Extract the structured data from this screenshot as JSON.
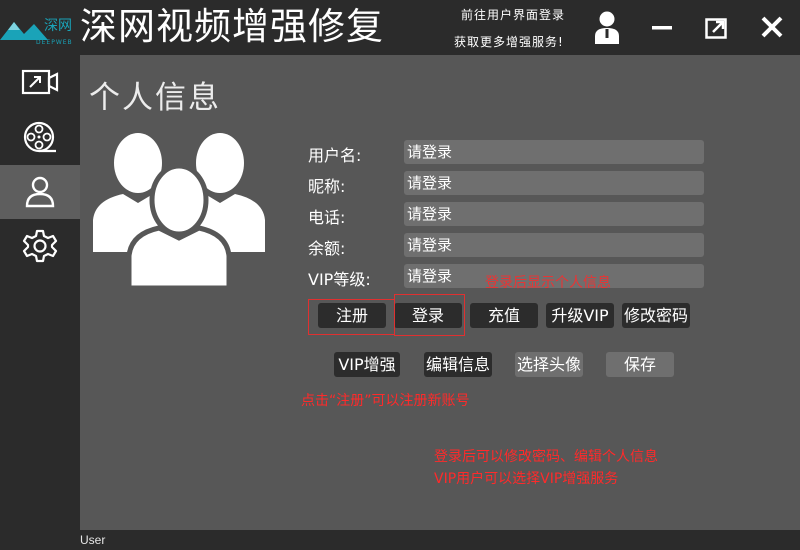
{
  "app": {
    "title": "深网视频增强修复",
    "logo_text": "深网",
    "logo_subtext": "DEEPWEB",
    "hint_line1": "前往用户界面登录",
    "hint_line2": "获取更多增强服务!"
  },
  "window_controls": [
    "user-icon",
    "minimize-icon",
    "restore-icon",
    "close-icon"
  ],
  "sidebar": {
    "items": [
      {
        "icon": "video-export-icon",
        "active": false
      },
      {
        "icon": "film-reel-icon",
        "active": false
      },
      {
        "icon": "user-outline-icon",
        "active": true
      },
      {
        "icon": "gear-icon",
        "active": false
      }
    ]
  },
  "section_title": "个人信息",
  "profile_fields": [
    {
      "label": "用户名:",
      "value": "请登录"
    },
    {
      "label": "昵称:",
      "value": "请登录"
    },
    {
      "label": "电话:",
      "value": "请登录"
    },
    {
      "label": "余额:",
      "value": "请登录"
    },
    {
      "label": "VIP等级:",
      "value": "请登录"
    }
  ],
  "buttons_row1": [
    "注册",
    "登录",
    "充值",
    "升级VIP",
    "修改密码"
  ],
  "buttons_row2": [
    "VIP增强",
    "编辑信息",
    "选择头像",
    "保存"
  ],
  "annotations": {
    "overlay": "登录后显示个人信息",
    "register_note": "点击“注册”可以注册新账号",
    "note_line1": "登录后可以修改密码、编辑个人信息",
    "note_line2": "VIP用户可以选择VIP增强服务"
  },
  "statusbar": {
    "text": "User"
  },
  "colors": {
    "background": "#575757",
    "chrome": "#2b2b2b",
    "field": "#6f6f6f",
    "annotation": "#ff2a2a",
    "logo_accent": "#1aa3b8"
  }
}
